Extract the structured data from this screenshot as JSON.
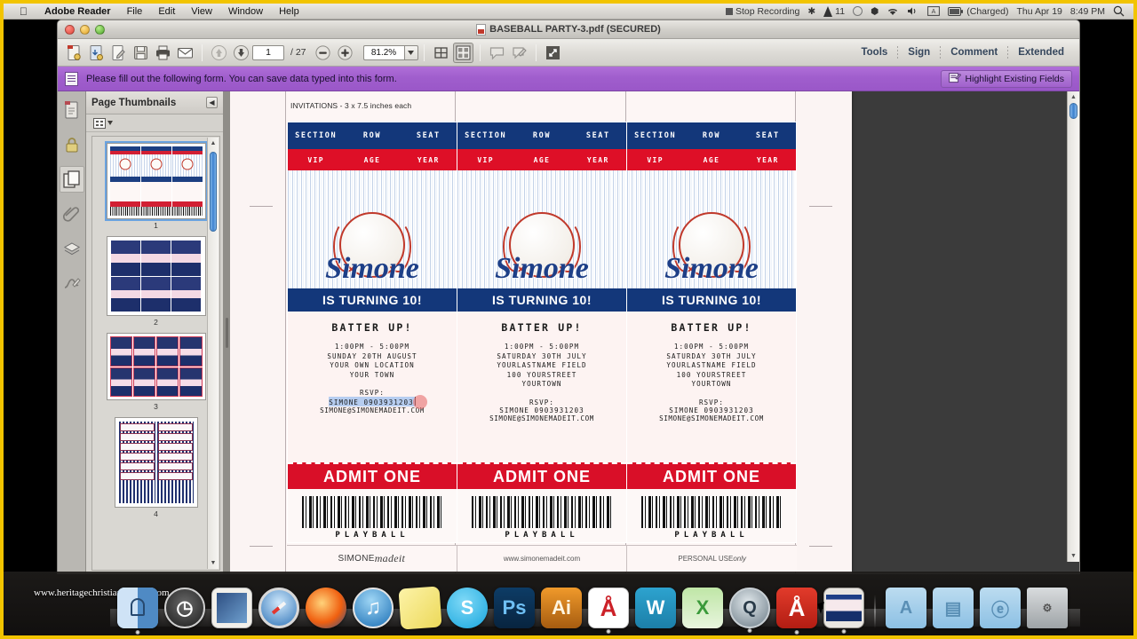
{
  "menubar": {
    "apple_icon": "apple-icon",
    "app_name": "Adobe Reader",
    "items": [
      "File",
      "Edit",
      "View",
      "Window",
      "Help"
    ],
    "status": {
      "stop_recording": "Stop Recording",
      "bluetooth_icon": "bluetooth-icon",
      "wifi_icon": "wifi-icon",
      "volume_icon": "volume-icon",
      "input_icon": "input-source-icon",
      "notification_count": "11",
      "battery": "(Charged)",
      "date": "Thu Apr 19",
      "time": "8:49 PM",
      "search_icon": "spotlight-search-icon"
    }
  },
  "window": {
    "title": "BASEBALL PARTY-3.pdf (SECURED)",
    "doc_icon": "pdf-document-icon"
  },
  "toolbar": {
    "buttons": [
      {
        "name": "create-pdf-button",
        "icon": "pdf-create-icon"
      },
      {
        "name": "open-file-button",
        "icon": "folder-download-icon"
      },
      {
        "name": "edit-pdf-button",
        "icon": "pencil-page-icon"
      },
      {
        "name": "save-button",
        "icon": "floppy-disk-icon"
      },
      {
        "name": "print-button",
        "icon": "printer-icon"
      },
      {
        "name": "email-button",
        "icon": "envelope-icon"
      }
    ],
    "prev_page_icon": "arrow-up-icon",
    "next_page_icon": "arrow-down-icon",
    "page_number": "1",
    "page_count": "/ 27",
    "zoom_out_icon": "minus-circle-icon",
    "zoom_in_icon": "plus-circle-icon",
    "zoom_level": "81.2%",
    "zoom_dropdown_icon": "chevron-down-icon",
    "fit_width_icon": "fit-width-icon",
    "fit_page_icon": "fit-page-icon",
    "comment_icon": "speech-bubble-icon",
    "markup_icon": "markup-pencil-icon",
    "fullscreen_icon": "expand-arrows-icon",
    "right_items": [
      "Tools",
      "Sign",
      "Comment",
      "Extended"
    ]
  },
  "notice": {
    "icon": "form-document-icon",
    "message": "Please fill out the following form. You can save data typed into this form.",
    "highlight_button": "Highlight Existing Fields",
    "highlight_icon": "highlight-fields-icon"
  },
  "rail": {
    "items": [
      {
        "name": "sidebar-icon-attachments-page",
        "icon": "page-thumb-icon"
      },
      {
        "name": "sidebar-icon-security",
        "icon": "lock-icon"
      },
      {
        "name": "sidebar-icon-page-thumbnails",
        "icon": "pages-icon",
        "active": true
      },
      {
        "name": "sidebar-icon-attachments",
        "icon": "paperclip-icon"
      },
      {
        "name": "sidebar-icon-layers",
        "icon": "layers-icon"
      },
      {
        "name": "sidebar-icon-signatures",
        "icon": "signature-icon"
      }
    ]
  },
  "thumbnails": {
    "title": "Page Thumbnails",
    "collapse_icon": "collapse-panel-icon",
    "options_icon": "options-menu-icon",
    "options_caret_icon": "caret-down-icon",
    "pages": [
      {
        "number": "1",
        "selected": true
      },
      {
        "number": "2",
        "selected": false
      },
      {
        "number": "3",
        "selected": false
      },
      {
        "number": "4",
        "selected": false
      }
    ],
    "scroll_up_icon": "scroll-up-arrow-icon",
    "scroll_down_icon": "scroll-down-arrow-icon"
  },
  "document": {
    "caption": "INVITATIONS - 3 x 7.5 inches each",
    "tickets": [
      {
        "header": [
          "SECTION",
          "ROW",
          "SEAT"
        ],
        "subheader": [
          "VIP",
          "AGE",
          "YEAR"
        ],
        "name": "Simone",
        "turning": "IS TURNING 10!",
        "batter": "BATTER UP!",
        "time": "1:00PM - 5:00PM",
        "date": "SUNDAY 20TH AUGUST",
        "venue": "YOUR OWN LOCATION",
        "street": "",
        "town": "YOUR TOWN",
        "rsvp_label": "RSVP:",
        "rsvp_phone": "SIMONE 0903931203",
        "rsvp_email": "SIMONE@SIMONEMADEIT.COM",
        "admit": "ADMIT ONE",
        "playball": "PLAYBALL",
        "field_focused": true
      },
      {
        "header": [
          "SECTION",
          "ROW",
          "SEAT"
        ],
        "subheader": [
          "VIP",
          "AGE",
          "YEAR"
        ],
        "name": "Simone",
        "turning": "IS TURNING 10!",
        "batter": "BATTER UP!",
        "time": "1:00PM - 5:00PM",
        "date": "SATURDAY 30TH JULY",
        "venue": "YOURLASTNAME FIELD",
        "street": "100 YOURSTREET",
        "town": "YOURTOWN",
        "rsvp_label": "RSVP:",
        "rsvp_phone": "SIMONE 0903931203",
        "rsvp_email": "SIMONE@SIMONEMADEIT.COM",
        "admit": "ADMIT ONE",
        "playball": "PLAYBALL",
        "field_focused": false
      },
      {
        "header": [
          "SECTION",
          "ROW",
          "SEAT"
        ],
        "subheader": [
          "VIP",
          "AGE",
          "YEAR"
        ],
        "name": "Simone",
        "turning": "IS TURNING 10!",
        "batter": "BATTER UP!",
        "time": "1:00PM - 5:00PM",
        "date": "SATURDAY 30TH JULY",
        "venue": "YOURLASTNAME FIELD",
        "street": "100 YOURSTREET",
        "town": "YOURTOWN",
        "rsvp_label": "RSVP:",
        "rsvp_phone": "SIMONE 0903931203",
        "rsvp_email": "SIMONE@SIMONEMADEIT.COM",
        "admit": "ADMIT ONE",
        "playball": "PLAYBALL",
        "field_focused": false
      }
    ],
    "footer": {
      "brand_bold": "SIMONE",
      "brand_script": "madeit",
      "website": "www.simonemadeit.com",
      "usage_bold": "PERSONAL USE",
      "usage_script": "only"
    }
  },
  "dock": {
    "watermark": "www.heritagechristiancollege.com",
    "items": [
      {
        "name": "dock-item-finder",
        "label": ""
      },
      {
        "name": "dock-item-time-machine",
        "label": ""
      },
      {
        "name": "dock-item-mail",
        "label": ""
      },
      {
        "name": "dock-item-safari",
        "label": ""
      },
      {
        "name": "dock-item-firefox",
        "label": ""
      },
      {
        "name": "dock-item-itunes",
        "label": "♫"
      },
      {
        "name": "dock-item-stickies",
        "label": ""
      },
      {
        "name": "dock-item-skype",
        "label": "S"
      },
      {
        "name": "dock-item-photoshop",
        "label": "Ps"
      },
      {
        "name": "dock-item-illustrator",
        "label": "Ai"
      },
      {
        "name": "dock-item-acrobat",
        "label": "Å"
      },
      {
        "name": "dock-item-word",
        "label": "W"
      },
      {
        "name": "dock-item-excel",
        "label": "X"
      },
      {
        "name": "dock-item-quicktime",
        "label": "Q"
      },
      {
        "name": "dock-item-adobe-reader",
        "label": "Å"
      },
      {
        "name": "dock-item-screenshot-window",
        "label": ""
      },
      {
        "name": "dock-item-applications-folder",
        "label": "A"
      },
      {
        "name": "dock-item-documents-folder",
        "label": "▤"
      },
      {
        "name": "dock-item-downloads-folder",
        "label": "ⓔ"
      },
      {
        "name": "dock-item-trash",
        "label": ""
      }
    ]
  },
  "colors": {
    "navy": "#13377a",
    "red": "#de0f27",
    "purple_bar": "#a05ecd",
    "accent_yellow": "#f2c400"
  }
}
